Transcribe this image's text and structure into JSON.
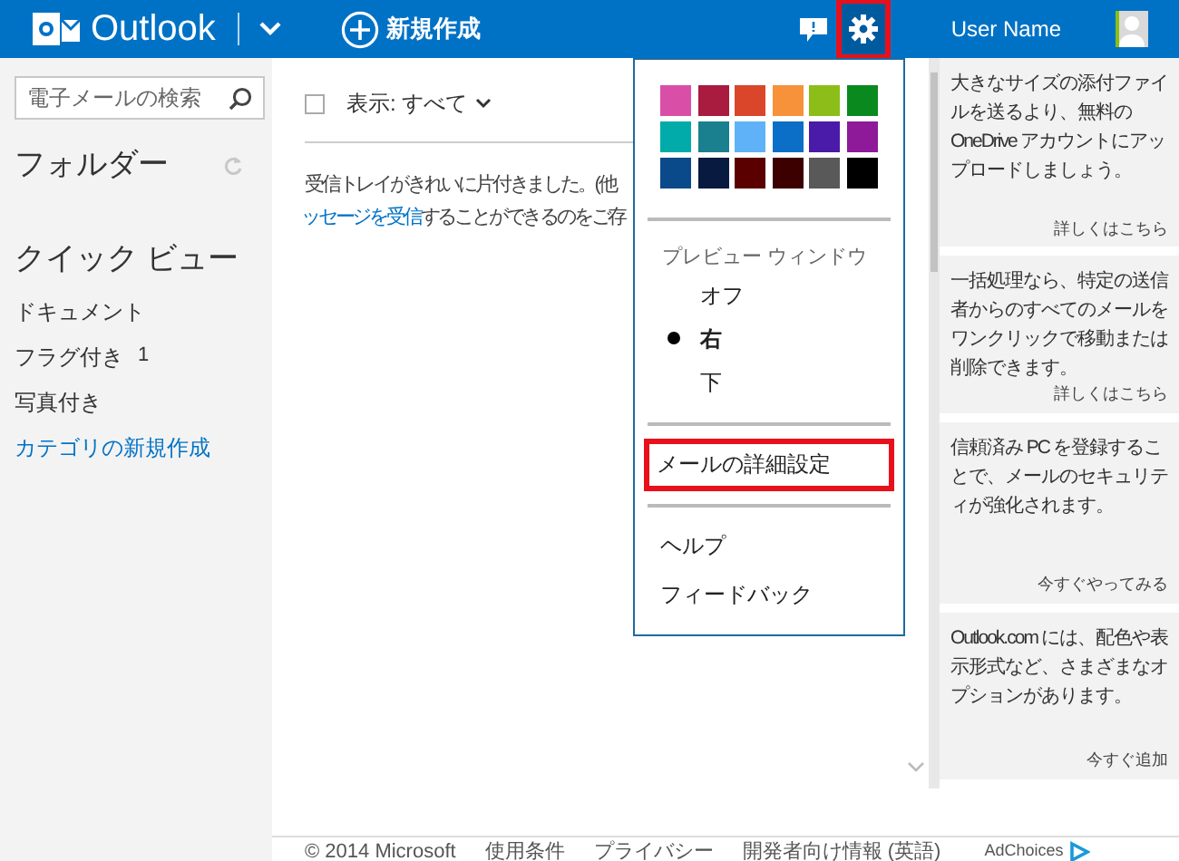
{
  "header": {
    "app_name": "Outlook",
    "new_button": "新規作成",
    "user_name": "User Name",
    "settings_highlighted": true
  },
  "sidebar": {
    "search_placeholder": "電子メールの検索",
    "folders_title": "フォルダー",
    "quick_views_title": "クイック ビュー",
    "items": [
      {
        "kind": "item",
        "label": "ドキュメント"
      },
      {
        "kind": "item",
        "label": "フラグ付き",
        "count": "1"
      },
      {
        "kind": "item",
        "label": "写真付き"
      },
      {
        "kind": "link",
        "label": "カテゴリの新規作成"
      }
    ]
  },
  "main": {
    "filter_label": "表示: すべて",
    "select_all_checked": false,
    "message_line_1": "受信トレイがきれいに片付きました。(他",
    "message_link": "ッセージを受信",
    "message_line_2": "することができるのをご存"
  },
  "settings_menu": {
    "colors": [
      {
        "color": "#d94fa8"
      },
      {
        "color": "#a91b3f"
      },
      {
        "color": "#d9462a"
      },
      {
        "color": "#f7913a"
      },
      {
        "color": "#8cbd18"
      },
      {
        "color": "#0a8a1e"
      },
      {
        "color": "#00aba9"
      },
      {
        "color": "#1a7f8e"
      },
      {
        "color": "#5fb2f7"
      },
      {
        "color": "#0b6ec7"
      },
      {
        "color": "#4a1aa8"
      },
      {
        "color": "#8e1a9a"
      },
      {
        "color": "#0b4a8a"
      },
      {
        "color": "#081a40"
      },
      {
        "color": "#5a0000"
      },
      {
        "color": "#3c0000"
      },
      {
        "color": "#595959"
      },
      {
        "color": "#000000"
      }
    ],
    "preview_title": "プレビュー ウィンドウ",
    "preview_options": [
      {
        "label": "オフ",
        "selected": false
      },
      {
        "label": "右",
        "selected": true
      },
      {
        "label": "下",
        "selected": false
      }
    ],
    "options_item": {
      "label": "メールの詳細設定",
      "highlighted": true
    },
    "help_items": [
      "ヘルプ",
      "フィードバック"
    ]
  },
  "ads": [
    {
      "text": "大きなサイズの添付ファイルを送るより、無料の OneDrive アカウントにアップロードしましょう。",
      "link": "詳しくはこちら"
    },
    {
      "text": "一括処理なら、特定の送信者からのすべてのメールをワンクリックで移動または削除できます。",
      "link": "詳しくはこちら"
    },
    {
      "text": "信頼済み PC を登録することで、メールのセキュリティが強化されます。",
      "link": "今すぐやってみる"
    },
    {
      "text": "Outlook.com には、配色や表示形式など、さまざまなオプションがあります。",
      "link": "今すぐ追加"
    }
  ],
  "footer": {
    "links": [
      "© 2014 Microsoft",
      "使用条件",
      "プライバシー",
      "開発者向け情報 (英語)"
    ],
    "adchoices": "AdChoices"
  }
}
